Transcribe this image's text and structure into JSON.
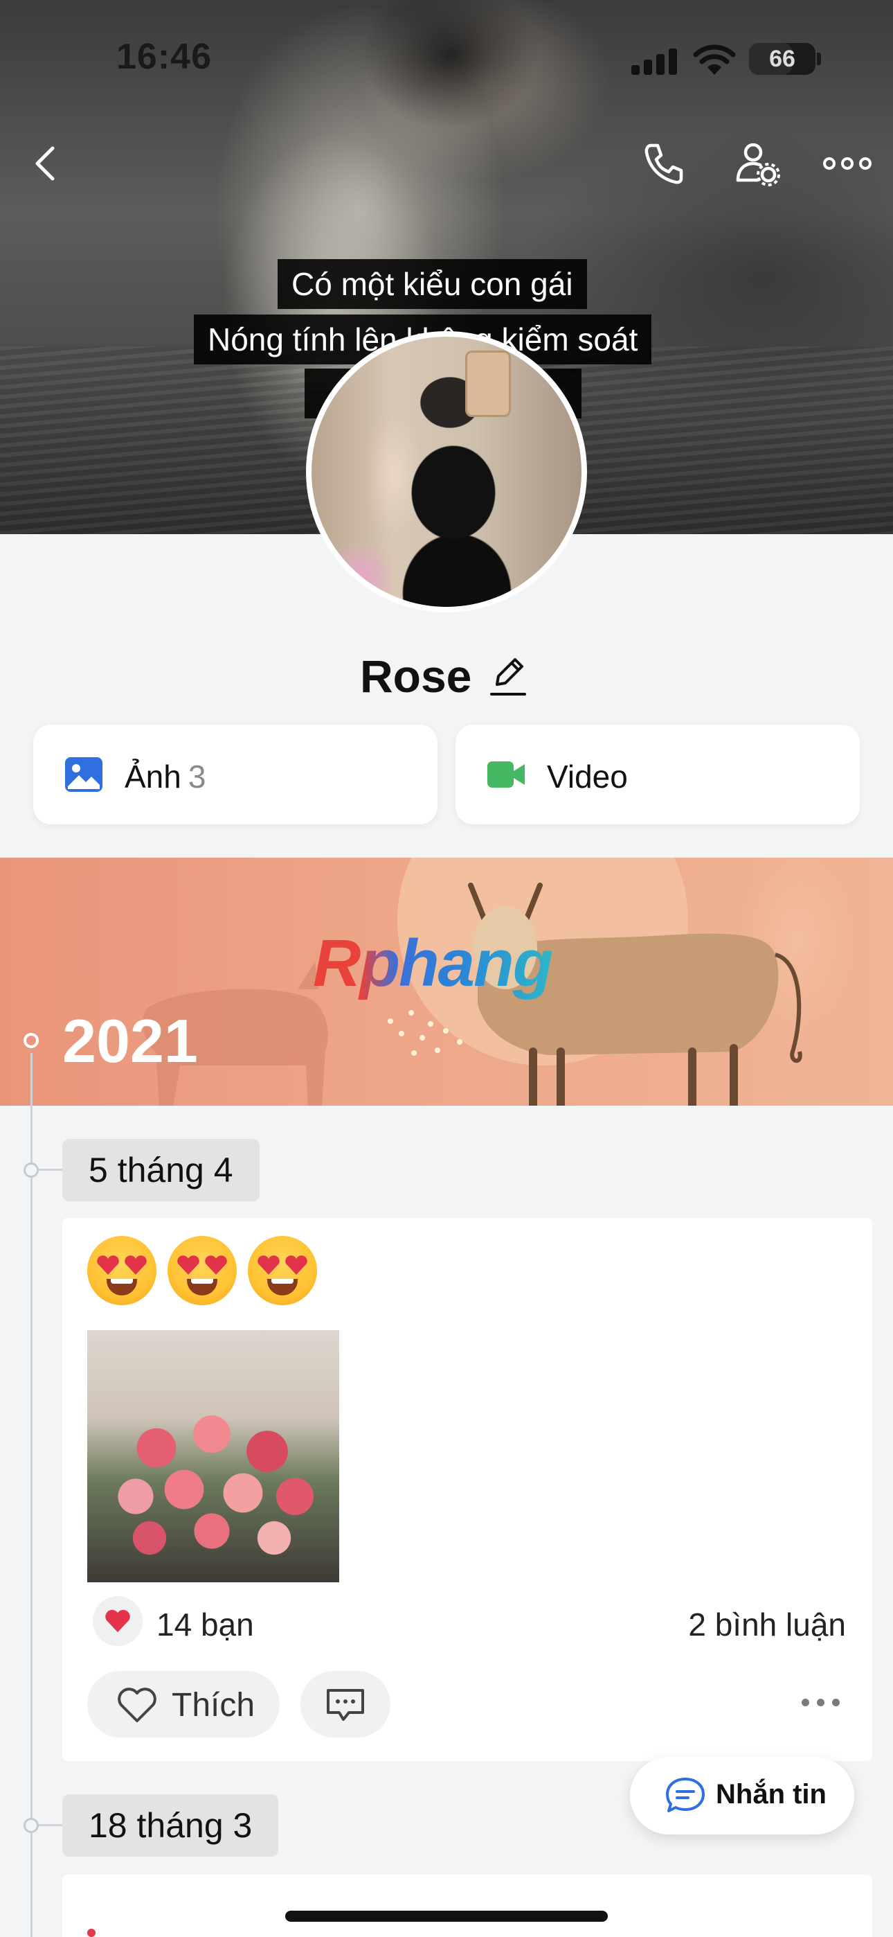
{
  "status_bar": {
    "time": "16:46",
    "battery": "66"
  },
  "cover": {
    "caption_lines": [
      "Có một kiểu con gái",
      "Nóng tính lên không kiểm soát"
    ]
  },
  "profile": {
    "name": "Rose"
  },
  "media": {
    "photos_label": "Ảnh",
    "photos_count": "3",
    "videos_label": "Video"
  },
  "year_banner": {
    "year": "2021",
    "watermark": "Rphang"
  },
  "timeline": {
    "dates": [
      "5 tháng 4",
      "18 tháng 3"
    ]
  },
  "post": {
    "emoji": [
      "smiling-face-with-heart-eyes",
      "smiling-face-with-heart-eyes",
      "smiling-face-with-heart-eyes"
    ],
    "likes": "14 bạn",
    "comments": "2 bình luận",
    "like_label": "Thích"
  },
  "message_button": {
    "label": "Nhắn tin"
  },
  "colors": {
    "accent_blue": "#2f6fe0",
    "video_green": "#46b863",
    "banner_orange": "#eea689",
    "heart_red": "#e3334a"
  },
  "icons": [
    "back-icon",
    "phone-icon",
    "user-settings-icon",
    "more-icon",
    "edit-icon",
    "image-icon",
    "video-camera-icon",
    "heart-icon",
    "comment-icon",
    "chat-icon"
  ]
}
